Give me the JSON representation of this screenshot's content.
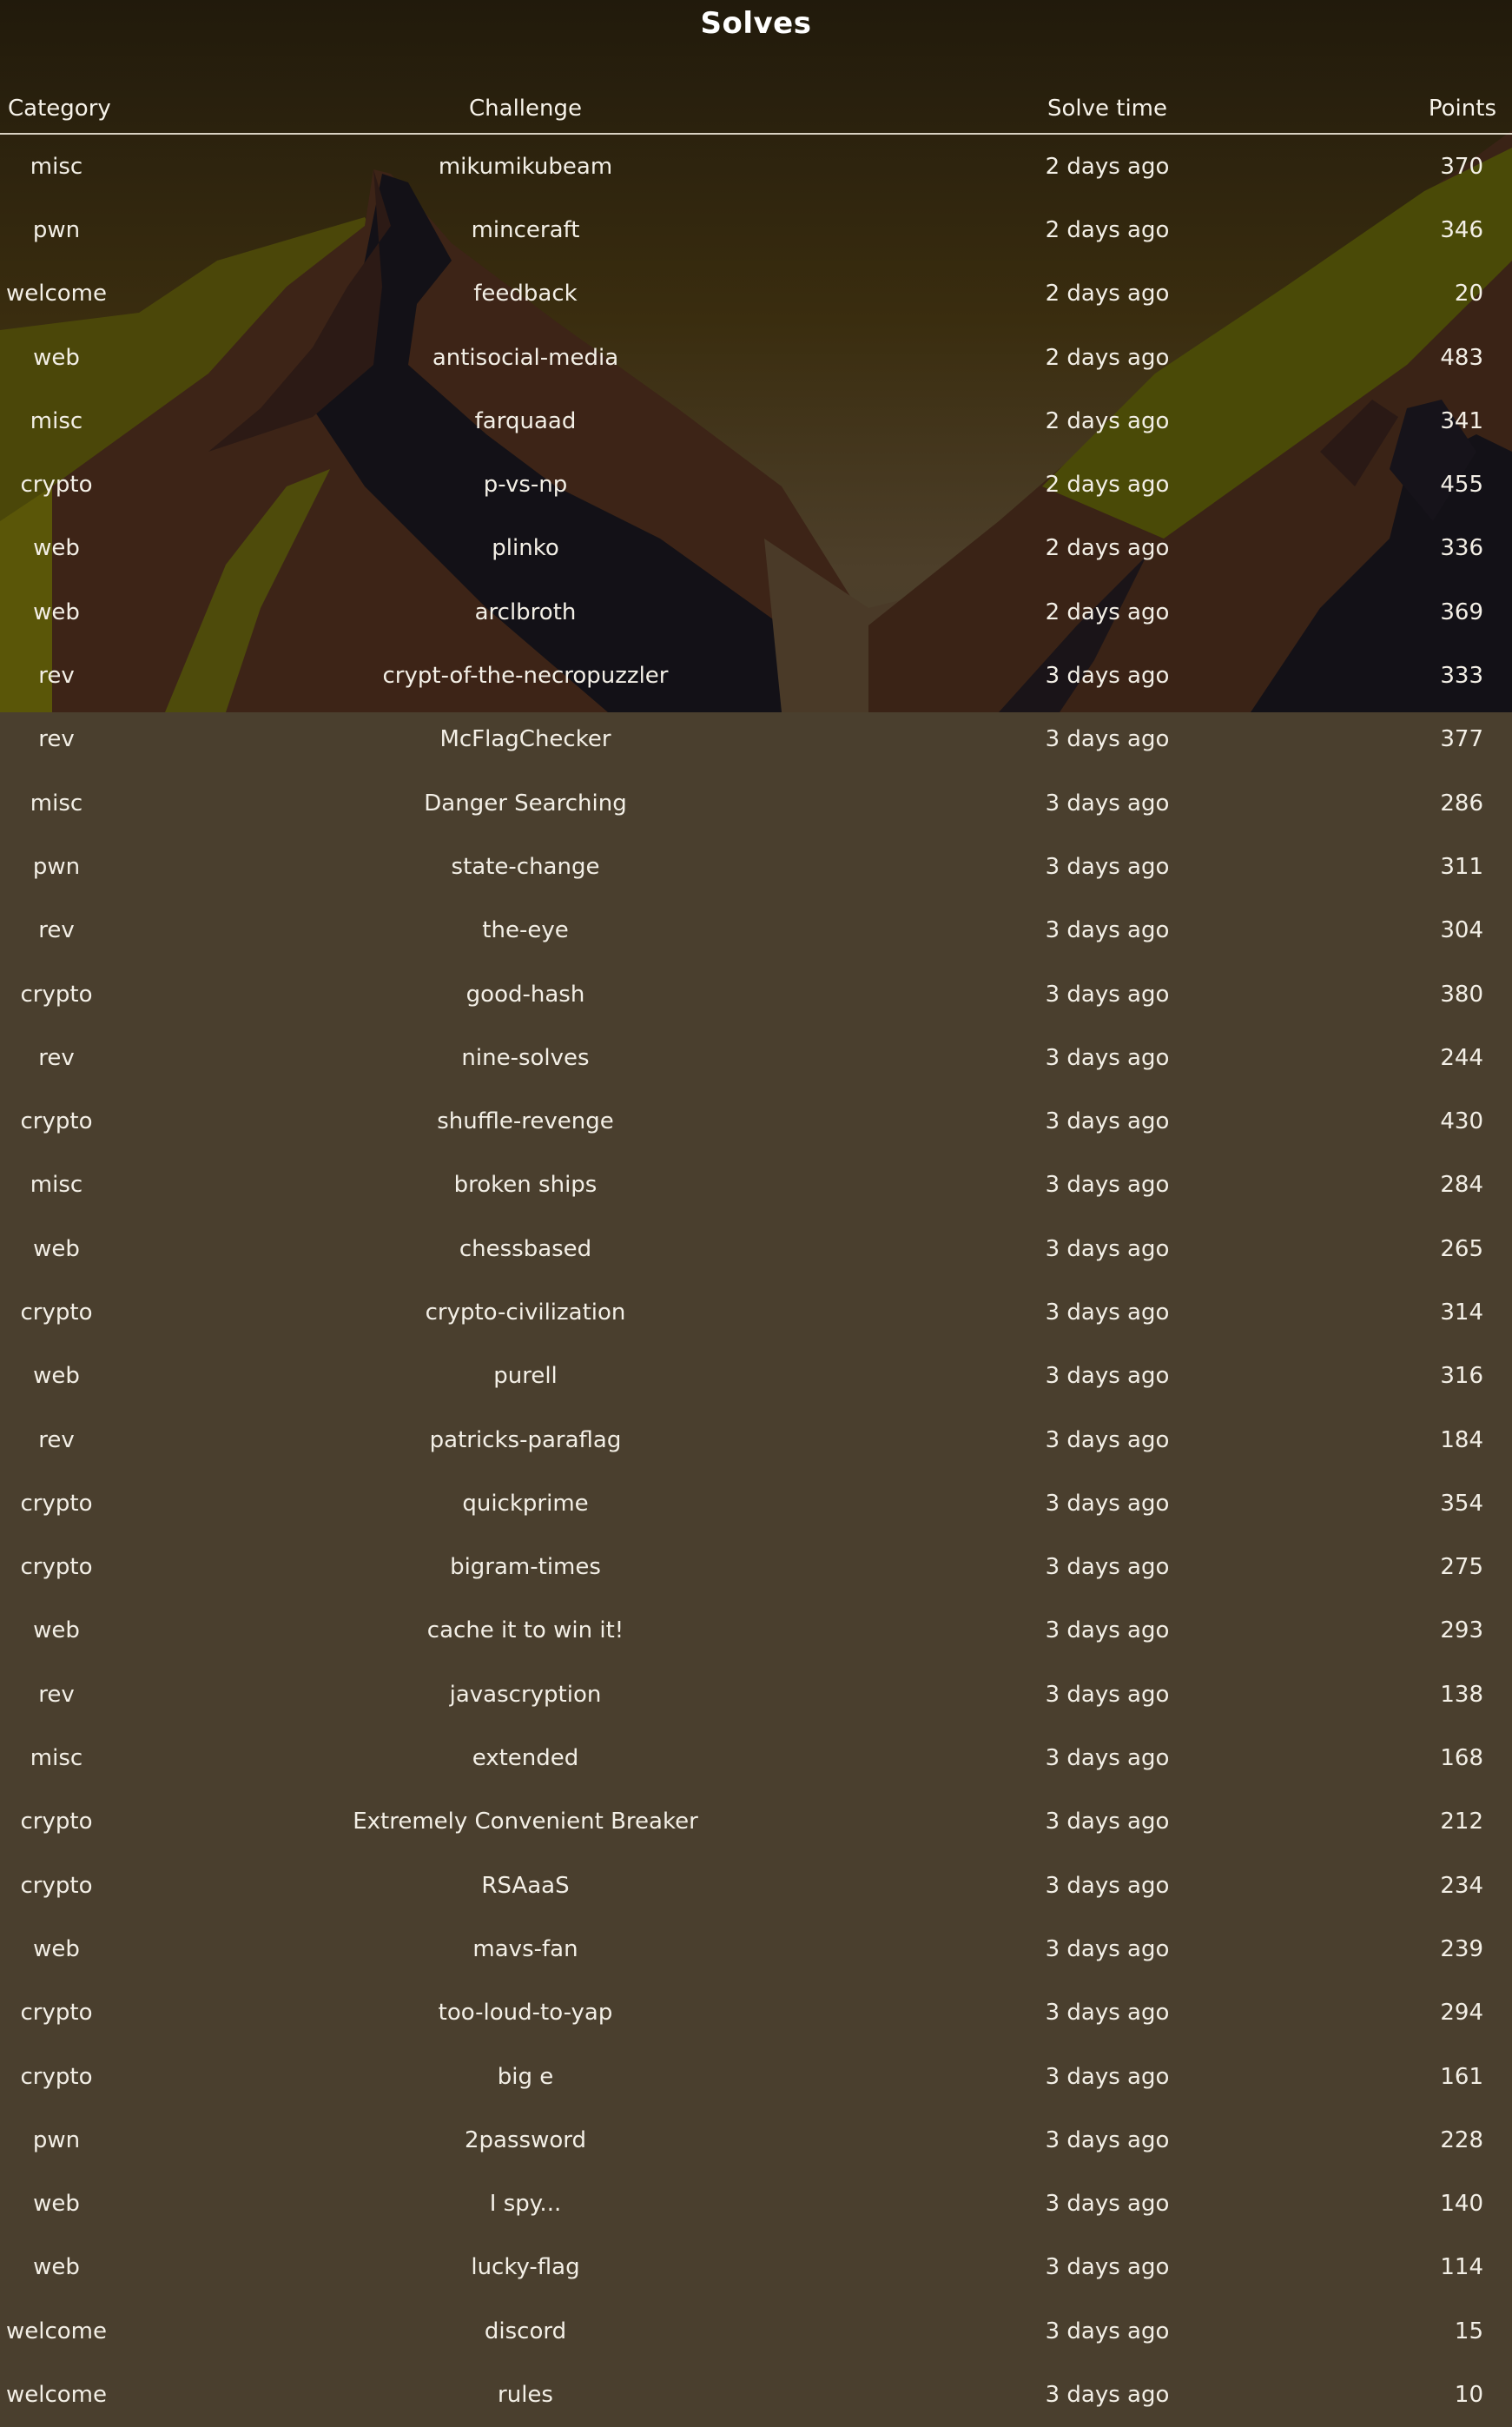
{
  "page": {
    "title": "Solves"
  },
  "table": {
    "headers": {
      "category": "Category",
      "challenge": "Challenge",
      "solve_time": "Solve time",
      "points": "Points"
    },
    "rows": [
      {
        "category": "misc",
        "challenge": "mikumikubeam",
        "solve_time": "2 days ago",
        "points": "370"
      },
      {
        "category": "pwn",
        "challenge": "minceraft",
        "solve_time": "2 days ago",
        "points": "346"
      },
      {
        "category": "welcome",
        "challenge": "feedback",
        "solve_time": "2 days ago",
        "points": "20"
      },
      {
        "category": "web",
        "challenge": "antisocial-media",
        "solve_time": "2 days ago",
        "points": "483"
      },
      {
        "category": "misc",
        "challenge": "farquaad",
        "solve_time": "2 days ago",
        "points": "341"
      },
      {
        "category": "crypto",
        "challenge": "p-vs-np",
        "solve_time": "2 days ago",
        "points": "455"
      },
      {
        "category": "web",
        "challenge": "plinko",
        "solve_time": "2 days ago",
        "points": "336"
      },
      {
        "category": "web",
        "challenge": "arclbroth",
        "solve_time": "2 days ago",
        "points": "369"
      },
      {
        "category": "rev",
        "challenge": "crypt-of-the-necropuzzler",
        "solve_time": "3 days ago",
        "points": "333"
      },
      {
        "category": "rev",
        "challenge": "McFlagChecker",
        "solve_time": "3 days ago",
        "points": "377"
      },
      {
        "category": "misc",
        "challenge": "Danger Searching",
        "solve_time": "3 days ago",
        "points": "286"
      },
      {
        "category": "pwn",
        "challenge": "state-change",
        "solve_time": "3 days ago",
        "points": "311"
      },
      {
        "category": "rev",
        "challenge": "the-eye",
        "solve_time": "3 days ago",
        "points": "304"
      },
      {
        "category": "crypto",
        "challenge": "good-hash",
        "solve_time": "3 days ago",
        "points": "380"
      },
      {
        "category": "rev",
        "challenge": "nine-solves",
        "solve_time": "3 days ago",
        "points": "244"
      },
      {
        "category": "crypto",
        "challenge": "shuffle-revenge",
        "solve_time": "3 days ago",
        "points": "430"
      },
      {
        "category": "misc",
        "challenge": "broken ships",
        "solve_time": "3 days ago",
        "points": "284"
      },
      {
        "category": "web",
        "challenge": "chessbased",
        "solve_time": "3 days ago",
        "points": "265"
      },
      {
        "category": "crypto",
        "challenge": "crypto-civilization",
        "solve_time": "3 days ago",
        "points": "314"
      },
      {
        "category": "web",
        "challenge": "purell",
        "solve_time": "3 days ago",
        "points": "316"
      },
      {
        "category": "rev",
        "challenge": "patricks-paraflag",
        "solve_time": "3 days ago",
        "points": "184"
      },
      {
        "category": "crypto",
        "challenge": "quickprime",
        "solve_time": "3 days ago",
        "points": "354"
      },
      {
        "category": "crypto",
        "challenge": "bigram-times",
        "solve_time": "3 days ago",
        "points": "275"
      },
      {
        "category": "web",
        "challenge": "cache it to win it!",
        "solve_time": "3 days ago",
        "points": "293"
      },
      {
        "category": "rev",
        "challenge": "javascryption",
        "solve_time": "3 days ago",
        "points": "138"
      },
      {
        "category": "misc",
        "challenge": "extended",
        "solve_time": "3 days ago",
        "points": "168"
      },
      {
        "category": "crypto",
        "challenge": "Extremely Convenient Breaker",
        "solve_time": "3 days ago",
        "points": "212"
      },
      {
        "category": "crypto",
        "challenge": "RSAaaS",
        "solve_time": "3 days ago",
        "points": "234"
      },
      {
        "category": "web",
        "challenge": "mavs-fan",
        "solve_time": "3 days ago",
        "points": "239"
      },
      {
        "category": "crypto",
        "challenge": "too-loud-to-yap",
        "solve_time": "3 days ago",
        "points": "294"
      },
      {
        "category": "crypto",
        "challenge": "big e",
        "solve_time": "3 days ago",
        "points": "161"
      },
      {
        "category": "pwn",
        "challenge": "2password",
        "solve_time": "3 days ago",
        "points": "228"
      },
      {
        "category": "web",
        "challenge": "I spy...",
        "solve_time": "3 days ago",
        "points": "140"
      },
      {
        "category": "web",
        "challenge": "lucky-flag",
        "solve_time": "3 days ago",
        "points": "114"
      },
      {
        "category": "welcome",
        "challenge": "discord",
        "solve_time": "3 days ago",
        "points": "15"
      },
      {
        "category": "welcome",
        "challenge": "rules",
        "solve_time": "3 days ago",
        "points": "10"
      }
    ]
  },
  "colors": {
    "page_background": "#4a3f2e",
    "banner_top": "#221a0d",
    "text": "#f3efe6",
    "mountain_dark": "#121015",
    "mountain_red": "#3e2418",
    "mountain_olive": "#4a4a06"
  }
}
